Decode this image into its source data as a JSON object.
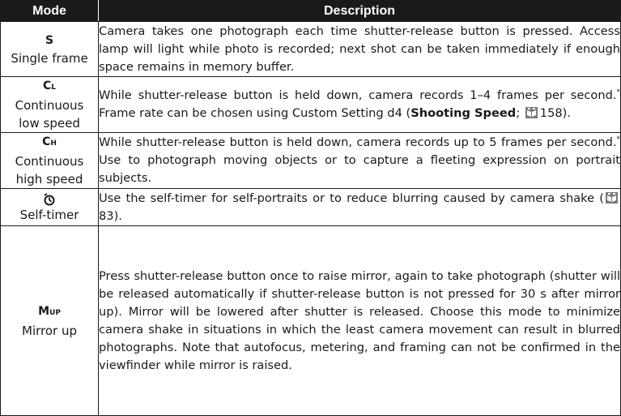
{
  "header": {
    "mode": "Mode",
    "description": "Description"
  },
  "rows": [
    {
      "symbol": "S",
      "name": "Single frame",
      "description": "Camera takes one photograph each time shutter-release button is pressed. Access lamp will light while photo is recorded; next shot can be taken immediately if enough space remains in memory buffer."
    },
    {
      "symbol_main": "C",
      "symbol_sub": "L",
      "name_line1": "Continuous",
      "name_line2": "low speed",
      "desc_a": "While shutter-release button is held down, camera records 1–4 frames per second.",
      "desc_sup": "*",
      "desc_b": " Frame rate can be chosen using Custom Setting d4 (",
      "desc_bold": "Shooting Speed",
      "desc_c": "; ",
      "page_ref": "158",
      "desc_d": ")."
    },
    {
      "symbol_main": "C",
      "symbol_sub": "H",
      "name_line1": "Continuous",
      "name_line2": "high speed",
      "desc_a": "While shutter-release button is held down, camera records up to 5 frames per second.",
      "desc_sup": "*",
      "desc_b": " Use to photograph moving objects or to capture a fleeting expression on portrait subjects."
    },
    {
      "symbol_icon": "self-timer-icon",
      "name": "Self-timer",
      "desc_a": "Use the self-timer for self-portraits or to reduce blurring caused by camera shake (",
      "page_ref": "83",
      "desc_b": ")."
    },
    {
      "symbol_main": "M",
      "symbol_sub": "UP",
      "name": "Mirror up",
      "description": "Press shutter-release button once to raise mirror, again to take photograph (shutter will be released automatically if shutter-release button is not pressed for 30 s after mirror up). Mirror will be lowered after shutter is released. Choose this mode to minimize camera shake in situations in which the least camera movement can result in blurred photographs. Note that autofocus, metering, and framing can not be confirmed in the viewfinder while mirror is raised."
    }
  ],
  "icons": {
    "page_reference": "page-reference-icon",
    "self_timer": "self-timer-icon"
  },
  "colors": {
    "header_bg": "#1a1a1a",
    "header_text": "#ffffff",
    "ref_icon": "#7a7a7a"
  }
}
